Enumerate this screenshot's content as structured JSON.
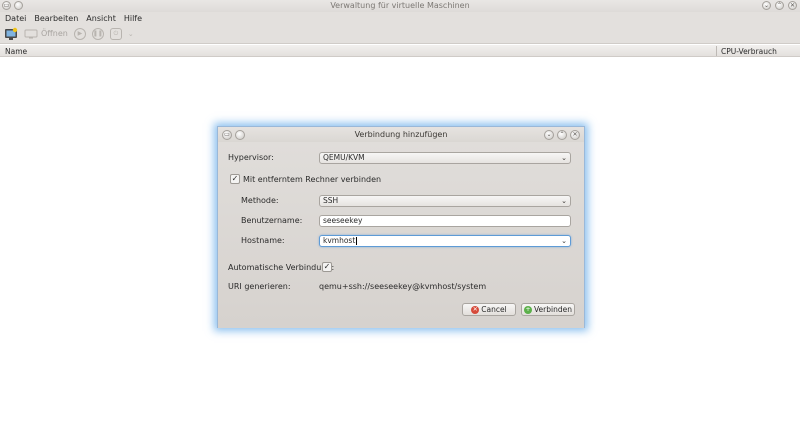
{
  "window": {
    "title": "Verwaltung für virtuelle Maschinen"
  },
  "menubar": {
    "items": [
      "Datei",
      "Bearbeiten",
      "Ansicht",
      "Hilfe"
    ]
  },
  "toolbar": {
    "open_label": "Öffnen"
  },
  "list": {
    "columns": [
      "Name",
      "CPU-Verbrauch"
    ]
  },
  "dialog": {
    "title": "Verbindung hinzufügen",
    "hypervisor": {
      "label": "Hypervisor:",
      "value": "QEMU/KVM"
    },
    "remote": {
      "label": "Mit entferntem Rechner verbinden",
      "checked": true
    },
    "method": {
      "label": "Methode:",
      "value": "SSH"
    },
    "username": {
      "label": "Benutzername:",
      "value": "seeseekey"
    },
    "hostname": {
      "label": "Hostname:",
      "value": "kvmhost"
    },
    "autoconnect": {
      "label": "Automatische Verbindung:",
      "checked": true
    },
    "uri": {
      "label": "URI generieren:",
      "value": "qemu+ssh://seeseekey@kvmhost/system"
    },
    "buttons": {
      "cancel": "Cancel",
      "connect": "Verbinden"
    }
  }
}
